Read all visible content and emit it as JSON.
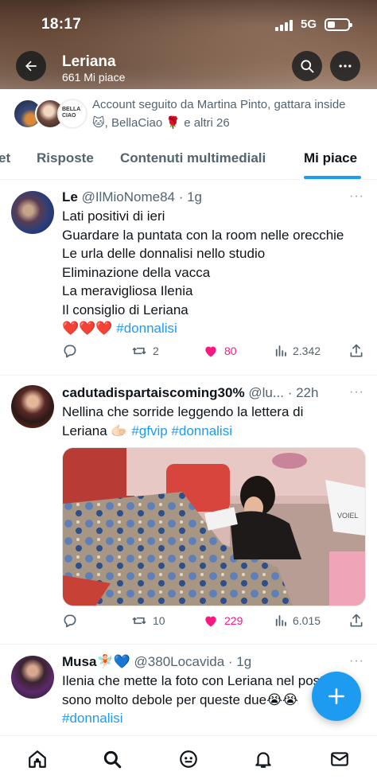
{
  "status_bar": {
    "time": "18:17",
    "network": "5G"
  },
  "header": {
    "name": "Leriana",
    "likes_count": "661 Mi piace"
  },
  "followed_by": {
    "text": "Account seguito da Martina Pinto, gattara inside 🐱, BellaCiao 🌹 e altri 26",
    "avatar3_text": "BELLA CIAO"
  },
  "tabs": [
    {
      "label": "et"
    },
    {
      "label": "Risposte"
    },
    {
      "label": "Contenuti multimediali"
    },
    {
      "label": "Mi piace",
      "active": true
    }
  ],
  "tweets": [
    {
      "name": "Le",
      "meta": "@IlMioNome84 · 1g",
      "lines": [
        "Lati positivi di ieri",
        "Guardare la puntata con la room nelle orecchie",
        "Le urla delle donnalisi nello studio",
        "Eliminazione della vacca",
        "La meravigliosa Ilenia",
        "Il consiglio di Leriana"
      ],
      "last_line_prefix": "❤️❤️❤️",
      "last_line_hashtag": "#donnalisi",
      "retweets": "2",
      "likes": "80",
      "views": "2.342"
    },
    {
      "name": "cadutadispartaiscoming30%",
      "meta": "@lu... · 22h",
      "line1": "Nellina che sorride leggendo la lettera di",
      "line2_text": "Leriana 🫱🏻",
      "line2_hashtags": "#gfvip #donnalisi",
      "retweets": "10",
      "likes": "229",
      "views": "6.015",
      "media_text": "VOIEL"
    },
    {
      "name": "Musa🧚🏻💙",
      "meta": "@380Locavida · 1g",
      "line1": "Ilenia che mette la foto con Leriana nel post",
      "line2": "sono molto debole per queste due😭😭",
      "line3_hashtag": "#donnalisi"
    }
  ],
  "colors": {
    "accent": "#1d9bf0",
    "like": "#f91880",
    "muted": "#536471"
  },
  "icons": [
    "back-arrow-icon",
    "search-icon",
    "more-icon",
    "reply-icon",
    "retweet-icon",
    "heart-icon",
    "views-icon",
    "share-icon",
    "compose-icon",
    "home-icon",
    "explore-icon",
    "grok-icon",
    "notifications-icon",
    "messages-icon"
  ]
}
